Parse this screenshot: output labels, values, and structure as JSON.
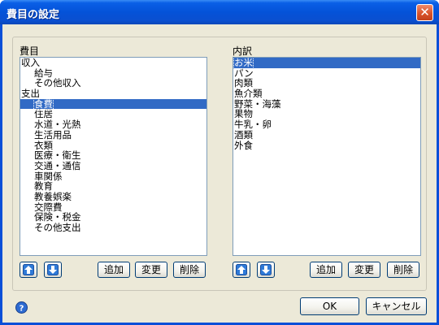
{
  "window": {
    "title": "費目の設定",
    "close_glyph": "✕"
  },
  "left": {
    "label": "費目",
    "items": [
      {
        "text": "収入",
        "indent": false,
        "selected": false
      },
      {
        "text": "給与",
        "indent": true,
        "selected": false
      },
      {
        "text": "その他収入",
        "indent": true,
        "selected": false
      },
      {
        "text": "支出",
        "indent": false,
        "selected": false
      },
      {
        "text": "食費",
        "indent": true,
        "selected": true
      },
      {
        "text": "住居",
        "indent": true,
        "selected": false
      },
      {
        "text": "水道・光熱",
        "indent": true,
        "selected": false
      },
      {
        "text": "生活用品",
        "indent": true,
        "selected": false
      },
      {
        "text": "衣類",
        "indent": true,
        "selected": false
      },
      {
        "text": "医療・衛生",
        "indent": true,
        "selected": false
      },
      {
        "text": "交通・通信",
        "indent": true,
        "selected": false
      },
      {
        "text": "車関係",
        "indent": true,
        "selected": false
      },
      {
        "text": "教育",
        "indent": true,
        "selected": false
      },
      {
        "text": "教養娯楽",
        "indent": true,
        "selected": false
      },
      {
        "text": "交際費",
        "indent": true,
        "selected": false
      },
      {
        "text": "保険・税金",
        "indent": true,
        "selected": false
      },
      {
        "text": "その他支出",
        "indent": true,
        "selected": false
      }
    ],
    "buttons": {
      "up_icon": "arrow-up-icon",
      "down_icon": "arrow-down-icon",
      "add": "追加",
      "edit": "変更",
      "delete": "削除"
    }
  },
  "right": {
    "label": "内訳",
    "items": [
      {
        "text": "お米",
        "indent": false,
        "selected": true
      },
      {
        "text": "パン",
        "indent": false,
        "selected": false
      },
      {
        "text": "肉類",
        "indent": false,
        "selected": false
      },
      {
        "text": "魚介類",
        "indent": false,
        "selected": false
      },
      {
        "text": "野菜・海藻",
        "indent": false,
        "selected": false
      },
      {
        "text": "果物",
        "indent": false,
        "selected": false
      },
      {
        "text": "牛乳・卵",
        "indent": false,
        "selected": false
      },
      {
        "text": "酒類",
        "indent": false,
        "selected": false
      },
      {
        "text": "外食",
        "indent": false,
        "selected": false
      }
    ],
    "buttons": {
      "up_icon": "arrow-up-icon",
      "down_icon": "arrow-down-icon",
      "add": "追加",
      "edit": "変更",
      "delete": "削除"
    }
  },
  "footer": {
    "help_icon": "help-icon",
    "ok": "OK",
    "cancel": "キャンセル"
  },
  "colors": {
    "title_bar": "#0452d8",
    "selection": "#316ac5",
    "dialog_bg": "#ece9d8",
    "arrow_blue": "#1e66c8"
  }
}
